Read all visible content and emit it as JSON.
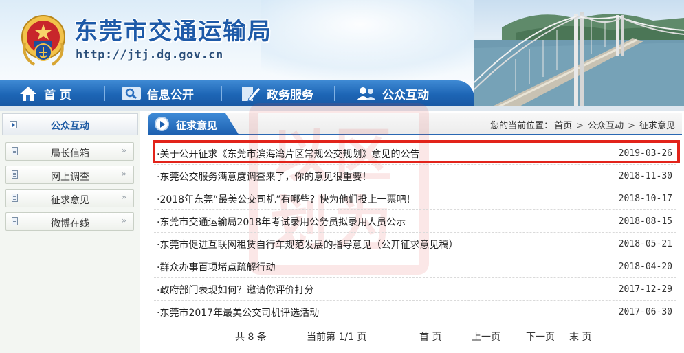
{
  "header": {
    "site_title": "东莞市交通运输局",
    "site_url": "http://jtj.dg.gov.cn"
  },
  "nav": {
    "items": [
      {
        "label": "首 页",
        "icon": "home-icon"
      },
      {
        "label": "信息公开",
        "icon": "search-icon"
      },
      {
        "label": "政务服务",
        "icon": "pen-icon"
      },
      {
        "label": "公众互动",
        "icon": "users-icon"
      }
    ]
  },
  "sidebar": {
    "title": "公众互动",
    "items": [
      {
        "label": "局长信箱"
      },
      {
        "label": "网上调查"
      },
      {
        "label": "征求意见"
      },
      {
        "label": "微博在线"
      }
    ],
    "chevron": "»"
  },
  "main": {
    "section_title": "征求意见",
    "breadcrumb": {
      "prefix": "您的当前位置：",
      "items": [
        "首页",
        "公众互动",
        "征求意见"
      ],
      "separator": ">"
    },
    "articles": [
      {
        "title": "关于公开征求《东莞市滨海湾片区常规公交规划》意见的公告",
        "date": "2019-03-26"
      },
      {
        "title": "东莞公交服务满意度调查来了，你的意见很重要！",
        "date": "2018-11-30"
      },
      {
        "title": "2018年东莞“最美公交司机”有哪些？快为他们投上一票吧！",
        "date": "2018-10-17"
      },
      {
        "title": "东莞市交通运输局2018年考试录用公务员拟录用人员公示",
        "date": "2018-08-15"
      },
      {
        "title": "东莞市促进互联网租赁自行车规范发展的指导意见（公开征求意见稿）",
        "date": "2018-05-21"
      },
      {
        "title": "群众办事百项堵点疏解行动",
        "date": "2018-04-20"
      },
      {
        "title": "政府部门表现如何？邀请你评价打分",
        "date": "2017-12-29"
      },
      {
        "title": "东莞市2017年最美公交司机评选活动",
        "date": "2017-06-30"
      }
    ],
    "bullet": "·",
    "pager": {
      "total": "共 8 条",
      "current": "当前第 1/1 页",
      "first": "首 页",
      "prev": "上一页",
      "next": "下一页",
      "last": "末 页"
    }
  },
  "watermark": {
    "text": "以区划为"
  },
  "colors": {
    "brand_blue": "#1d65b5",
    "highlight_red": "#e2231a"
  }
}
